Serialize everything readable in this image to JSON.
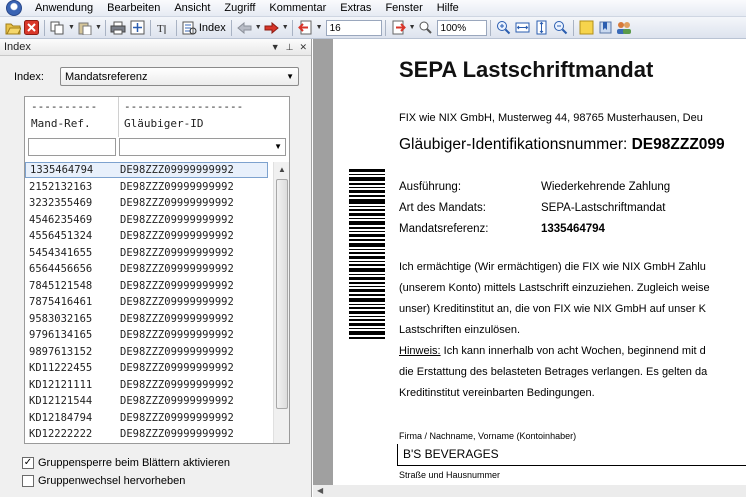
{
  "menubar": {
    "items": [
      "Anwendung",
      "Bearbeiten",
      "Ansicht",
      "Zugriff",
      "Kommentar",
      "Extras",
      "Fenster",
      "Hilfe"
    ]
  },
  "toolbar": {
    "index_label": "Index",
    "page_value": "16",
    "zoom_value": "100%"
  },
  "index_panel": {
    "title": "Index",
    "index_label": "Index:",
    "index_select_value": "Mandatsreferenz",
    "dash1": "----------",
    "dash2": "------------------",
    "col1_header": "Mand-Ref.",
    "col2_header": "Gläubiger-ID",
    "rows": [
      {
        "ref": "1335464794",
        "id": "DE98ZZZ09999999992"
      },
      {
        "ref": "2152132163",
        "id": "DE98ZZZ09999999992"
      },
      {
        "ref": "3232355469",
        "id": "DE98ZZZ09999999992"
      },
      {
        "ref": "4546235469",
        "id": "DE98ZZZ09999999992"
      },
      {
        "ref": "4556451324",
        "id": "DE98ZZZ09999999992"
      },
      {
        "ref": "5454341655",
        "id": "DE98ZZZ09999999992"
      },
      {
        "ref": "6564456656",
        "id": "DE98ZZZ09999999992"
      },
      {
        "ref": "7845121548",
        "id": "DE98ZZZ09999999992"
      },
      {
        "ref": "7875416461",
        "id": "DE98ZZZ09999999992"
      },
      {
        "ref": "9583032165",
        "id": "DE98ZZZ09999999992"
      },
      {
        "ref": "9796134165",
        "id": "DE98ZZZ09999999992"
      },
      {
        "ref": "9897613152",
        "id": "DE98ZZZ09999999992"
      },
      {
        "ref": "KD11222455",
        "id": "DE98ZZZ09999999992"
      },
      {
        "ref": "KD12121111",
        "id": "DE98ZZZ09999999992"
      },
      {
        "ref": "KD12121544",
        "id": "DE98ZZZ09999999992"
      },
      {
        "ref": "KD12184794",
        "id": "DE98ZZZ09999999992"
      },
      {
        "ref": "KD12222222",
        "id": "DE98ZZZ09999999992"
      }
    ],
    "checkbox1_label": "Gruppensperre beim Blättern aktivieren",
    "checkbox1_checked": true,
    "checkbox2_label": "Gruppenwechsel hervorheben",
    "checkbox2_checked": false
  },
  "document": {
    "title": "SEPA Lastschriftmandat",
    "address": "FIX wie NIX GmbH, Musterweg 44, 98765 Musterhausen, Deu",
    "glaeubiger_label": "Gläubiger-Identifikationsnummer: ",
    "glaeubiger_value": "DE98ZZZ099",
    "ausfuehrung_label": "Ausführung:",
    "ausfuehrung_value": "Wiederkehrende Zahlung",
    "art_label": "Art des Mandats:",
    "art_value": "SEPA-Lastschriftmandat",
    "mandatsref_label": "Mandatsreferenz:",
    "mandatsref_value": "1335464794",
    "para1": "Ich ermächtige (Wir ermächtigen) die FIX wie NIX GmbH Zahlu",
    "para2": "(unserem Konto) mittels Lastschrift einzuziehen. Zugleich weise",
    "para3": "unser) Kreditinstitut an, die von FIX wie NIX GmbH auf unser K",
    "para4": "Lastschriften einzulösen.",
    "hinweis_label": "Hinweis:",
    "para5": " Ich kann innerhalb von acht Wochen, beginnend mit d",
    "para6": "die Erstattung des belasteten Betrages verlangen. Es gelten da",
    "para7": "Kreditinstitut vereinbarten Bedingungen.",
    "firma_label": "Firma / Nachname, Vorname (Kontoinhaber)",
    "firma_value": "B'S BEVERAGES",
    "strasse_label": "Straße und Hausnummer"
  }
}
